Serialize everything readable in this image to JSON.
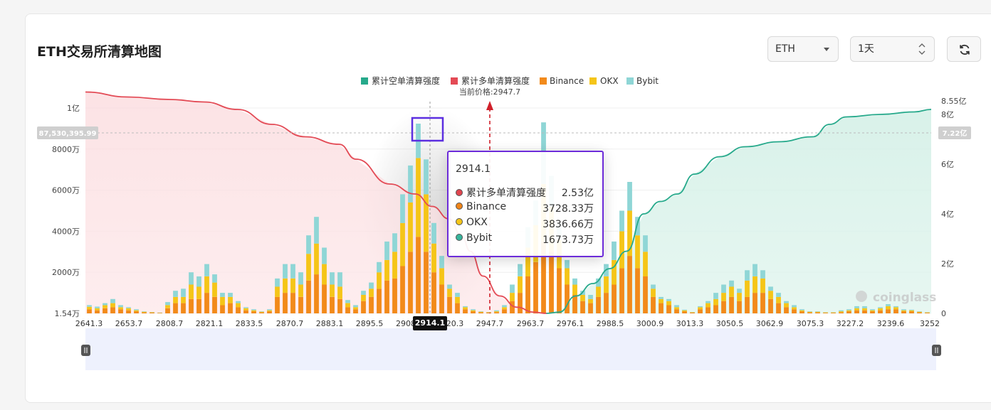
{
  "header": {
    "title": "ETH交易所清算地图",
    "coin_select": "ETH",
    "range_select": "1天"
  },
  "tooltip": {
    "title": "2914.1",
    "rows": [
      {
        "label": "累计多单清算强度",
        "value": "2.53亿",
        "color": "#e0444e"
      },
      {
        "label": "Binance",
        "value": "3728.33万",
        "color": "#f08418"
      },
      {
        "label": "OKX",
        "value": "3836.66万",
        "color": "#f5c518"
      },
      {
        "label": "Bybit",
        "value": "1673.73万",
        "color": "#37b49b"
      }
    ]
  },
  "current_price_label": "当前价格:2947.7",
  "crosshair_x_label": "2914.1",
  "crosshair_left_value": "87,530,395.99",
  "crosshair_right_value": "7.22亿",
  "watermark": "coinglass",
  "chart_data": {
    "type": "bar",
    "legend": [
      {
        "name": "累计空单清算强度",
        "color": "#26a98b"
      },
      {
        "name": "累计多单清算强度",
        "color": "#e34a55"
      },
      {
        "name": "Binance",
        "color": "#f28a1a"
      },
      {
        "name": "OKX",
        "color": "#f5c518"
      },
      {
        "name": "Bybit",
        "color": "#8fd6d6"
      }
    ],
    "x_ticks": [
      "2641.3",
      "2653.7",
      "2808.7",
      "2821.1",
      "2833.5",
      "2870.7",
      "2883.1",
      "2895.5",
      "2908",
      "2914.1",
      "2920.3",
      "2947.7",
      "2963.7",
      "2976.1",
      "2988.5",
      "3000.9",
      "3013.3",
      "3050.5",
      "3062.9",
      "3075.3",
      "3227.2",
      "3239.6",
      "3252"
    ],
    "y_left_ticks": [
      "1.54万",
      "2000万",
      "4000万",
      "6000万",
      "8000万",
      "1亿"
    ],
    "y_right_ticks": [
      "0",
      "2亿",
      "4亿",
      "6亿",
      "8亿",
      "8.55亿"
    ],
    "ylim_left": [
      15400,
      100000000
    ],
    "ylim_right": [
      0,
      855000000
    ],
    "current_price": 2947.7,
    "bars": [
      {
        "b": 2.0,
        "o": 1.2,
        "y": 0.8
      },
      {
        "b": 1.5,
        "o": 1.0,
        "y": 0.8
      },
      {
        "b": 2.5,
        "o": 1.5,
        "y": 1.0
      },
      {
        "b": 3.0,
        "o": 2.0,
        "y": 2.0
      },
      {
        "b": 2.0,
        "o": 1.0,
        "y": 1.0
      },
      {
        "b": 1.5,
        "o": 1.0,
        "y": 0.5
      },
      {
        "b": 1.0,
        "o": 0.5,
        "y": 0.5
      },
      {
        "b": 0.5,
        "o": 0.3,
        "y": 0.2
      },
      {
        "b": 0.4,
        "o": 0.2,
        "y": 0.1
      },
      {
        "b": 0.2,
        "o": 0.1,
        "y": 0.1
      },
      {
        "b": 2.5,
        "o": 1.5,
        "y": 1.5
      },
      {
        "b": 5.0,
        "o": 3.0,
        "y": 3.0
      },
      {
        "b": 5.0,
        "o": 3.0,
        "y": 4.0
      },
      {
        "b": 7.0,
        "o": 7.0,
        "y": 6.0
      },
      {
        "b": 7.0,
        "o": 6.0,
        "y": 5.0
      },
      {
        "b": 10.0,
        "o": 8.0,
        "y": 6.0
      },
      {
        "b": 8.0,
        "o": 7.0,
        "y": 4.0
      },
      {
        "b": 4.0,
        "o": 4.0,
        "y": 2.0
      },
      {
        "b": 5.0,
        "o": 3.0,
        "y": 2.0
      },
      {
        "b": 3.0,
        "o": 2.0,
        "y": 1.0
      },
      {
        "b": 1.5,
        "o": 1.0,
        "y": 0.5
      },
      {
        "b": 1.0,
        "o": 0.5,
        "y": 0.5
      },
      {
        "b": 0.5,
        "o": 0.3,
        "y": 0.2
      },
      {
        "b": 1.0,
        "o": 0.5,
        "y": 0.5
      },
      {
        "b": 8.0,
        "o": 5.0,
        "y": 4.0
      },
      {
        "b": 10.0,
        "o": 7.0,
        "y": 7.0
      },
      {
        "b": 10.0,
        "o": 7.0,
        "y": 7.0
      },
      {
        "b": 8.0,
        "o": 6.0,
        "y": 6.0
      },
      {
        "b": 16.0,
        "o": 13.0,
        "y": 9.0
      },
      {
        "b": 19.0,
        "o": 15.0,
        "y": 13.0
      },
      {
        "b": 14.0,
        "o": 10.0,
        "y": 8.0
      },
      {
        "b": 8.0,
        "o": 6.0,
        "y": 6.0
      },
      {
        "b": 7.0,
        "o": 6.0,
        "y": 7.0
      },
      {
        "b": 3.0,
        "o": 2.0,
        "y": 1.5
      },
      {
        "b": 2.0,
        "o": 1.0,
        "y": 1.0
      },
      {
        "b": 6.0,
        "o": 3.0,
        "y": 2.0
      },
      {
        "b": 8.0,
        "o": 4.0,
        "y": 3.0
      },
      {
        "b": 12.0,
        "o": 8.0,
        "y": 5.0
      },
      {
        "b": 16.0,
        "o": 10.0,
        "y": 9.0
      },
      {
        "b": 17.0,
        "o": 13.0,
        "y": 9.0
      },
      {
        "b": 23.0,
        "o": 21.0,
        "y": 14.0
      },
      {
        "b": 30.0,
        "o": 24.0,
        "y": 18.0
      },
      {
        "b": 37.28,
        "o": 38.37,
        "y": 16.74
      },
      {
        "b": 30.0,
        "o": 28.0,
        "y": 17.0
      },
      {
        "b": 20.0,
        "o": 14.0,
        "y": 10.0
      },
      {
        "b": 14.0,
        "o": 8.0,
        "y": 6.0
      },
      {
        "b": 8.0,
        "o": 4.0,
        "y": 2.0
      },
      {
        "b": 5.0,
        "o": 3.0,
        "y": 2.0
      },
      {
        "b": 2.0,
        "o": 1.0,
        "y": 0.5
      },
      {
        "b": 1.0,
        "o": 0.5,
        "y": 0.5
      },
      {
        "b": 0.5,
        "o": 0.3,
        "y": 0.2
      },
      {
        "b": 0.4,
        "o": 0.2,
        "y": 0.1
      },
      {
        "b": 0.6,
        "o": 0.4,
        "y": 0.5
      },
      {
        "b": 2.0,
        "o": 1.0,
        "y": 1.0
      },
      {
        "b": 6.0,
        "o": 4.0,
        "y": 4.0
      },
      {
        "b": 10.0,
        "o": 8.0,
        "y": 6.0
      },
      {
        "b": 18.0,
        "o": 14.0,
        "y": 10.0
      },
      {
        "b": 25.0,
        "o": 18.0,
        "y": 12.0
      },
      {
        "b": 35.0,
        "o": 28.0,
        "y": 30.0
      },
      {
        "b": 30.0,
        "o": 22.0,
        "y": 15.0
      },
      {
        "b": 22.0,
        "o": 14.0,
        "y": 8.0
      },
      {
        "b": 14.0,
        "o": 8.0,
        "y": 4.0
      },
      {
        "b": 9.0,
        "o": 5.0,
        "y": 3.0
      },
      {
        "b": 6.0,
        "o": 3.0,
        "y": 2.0
      },
      {
        "b": 5.0,
        "o": 2.0,
        "y": 2.0
      },
      {
        "b": 8.0,
        "o": 5.0,
        "y": 4.0
      },
      {
        "b": 10.0,
        "o": 8.0,
        "y": 6.0
      },
      {
        "b": 14.0,
        "o": 12.0,
        "y": 9.0
      },
      {
        "b": 22.0,
        "o": 18.0,
        "y": 10.0
      },
      {
        "b": 28.0,
        "o": 22.0,
        "y": 14.0
      },
      {
        "b": 22.0,
        "o": 16.0,
        "y": 9.0
      },
      {
        "b": 18.0,
        "o": 12.0,
        "y": 8.0
      },
      {
        "b": 8.0,
        "o": 4.0,
        "y": 2.0
      },
      {
        "b": 5.0,
        "o": 2.0,
        "y": 1.0
      },
      {
        "b": 4.0,
        "o": 2.0,
        "y": 1.0
      },
      {
        "b": 2.0,
        "o": 1.0,
        "y": 1.0
      },
      {
        "b": 1.0,
        "o": 0.5,
        "y": 0.3
      },
      {
        "b": 0.4,
        "o": 0.2,
        "y": 0.1
      },
      {
        "b": 2.0,
        "o": 1.0,
        "y": 0.5
      },
      {
        "b": 3.0,
        "o": 2.0,
        "y": 1.0
      },
      {
        "b": 4.0,
        "o": 3.0,
        "y": 3.0
      },
      {
        "b": 6.0,
        "o": 4.0,
        "y": 4.0
      },
      {
        "b": 8.0,
        "o": 5.0,
        "y": 3.0
      },
      {
        "b": 6.0,
        "o": 4.0,
        "y": 2.0
      },
      {
        "b": 8.0,
        "o": 8.0,
        "y": 5.0
      },
      {
        "b": 10.0,
        "o": 8.0,
        "y": 6.0
      },
      {
        "b": 10.0,
        "o": 7.0,
        "y": 4.0
      },
      {
        "b": 7.0,
        "o": 4.0,
        "y": 2.0
      },
      {
        "b": 5.0,
        "o": 3.0,
        "y": 2.0
      },
      {
        "b": 3.0,
        "o": 2.0,
        "y": 1.0
      },
      {
        "b": 2.0,
        "o": 1.0,
        "y": 1.0
      },
      {
        "b": 1.0,
        "o": 0.5,
        "y": 0.5
      },
      {
        "b": 0.5,
        "o": 0.3,
        "y": 0.2
      },
      {
        "b": 0.5,
        "o": 0.3,
        "y": 0.2
      },
      {
        "b": 0.3,
        "o": 0.2,
        "y": 0.1
      },
      {
        "b": 0.3,
        "o": 0.2,
        "y": 0.1
      },
      {
        "b": 0.5,
        "o": 0.5,
        "y": 0.5
      },
      {
        "b": 1.0,
        "o": 0.5,
        "y": 0.5
      },
      {
        "b": 1.5,
        "o": 1.0,
        "y": 1.0
      },
      {
        "b": 1.5,
        "o": 1.0,
        "y": 1.0
      },
      {
        "b": 1.0,
        "o": 0.5,
        "y": 0.5
      },
      {
        "b": 1.5,
        "o": 1.0,
        "y": 0.5
      },
      {
        "b": 2.0,
        "o": 1.5,
        "y": 1.0
      },
      {
        "b": 2.0,
        "o": 1.0,
        "y": 0.5
      },
      {
        "b": 1.0,
        "o": 0.5,
        "y": 0.5
      },
      {
        "b": 1.0,
        "o": 0.5,
        "y": 0.3
      },
      {
        "b": 0.5,
        "o": 0.3,
        "y": 0.2
      },
      {
        "b": 0.3,
        "o": 0.2,
        "y": 0.1
      }
    ],
    "long_curve": [
      [
        0,
        8.9
      ],
      [
        0.05,
        8.7
      ],
      [
        0.1,
        8.6
      ],
      [
        0.14,
        8.5
      ],
      [
        0.18,
        8.2
      ],
      [
        0.22,
        7.6
      ],
      [
        0.26,
        7.1
      ],
      [
        0.3,
        6.8
      ],
      [
        0.32,
        6.2
      ],
      [
        0.36,
        5.2
      ],
      [
        0.39,
        4.8
      ],
      [
        0.41,
        4.3
      ],
      [
        0.43,
        3.8
      ],
      [
        0.445,
        3.1
      ],
      [
        0.455,
        2.5
      ],
      [
        0.47,
        1.5
      ],
      [
        0.49,
        0.7
      ],
      [
        0.51,
        0.25
      ],
      [
        0.53,
        0.05
      ],
      [
        0.545,
        0
      ]
    ],
    "short_curve": [
      [
        0.545,
        0
      ],
      [
        0.56,
        0.05
      ],
      [
        0.58,
        0.7
      ],
      [
        0.6,
        1.2
      ],
      [
        0.62,
        1.8
      ],
      [
        0.64,
        2.5
      ],
      [
        0.66,
        4.0
      ],
      [
        0.68,
        4.5
      ],
      [
        0.7,
        4.8
      ],
      [
        0.72,
        5.6
      ],
      [
        0.75,
        6.3
      ],
      [
        0.78,
        6.7
      ],
      [
        0.82,
        6.9
      ],
      [
        0.86,
        7.1
      ],
      [
        0.88,
        7.6
      ],
      [
        0.9,
        7.9
      ],
      [
        0.94,
        8.0
      ],
      [
        0.98,
        8.1
      ],
      [
        1.0,
        8.2
      ]
    ]
  }
}
